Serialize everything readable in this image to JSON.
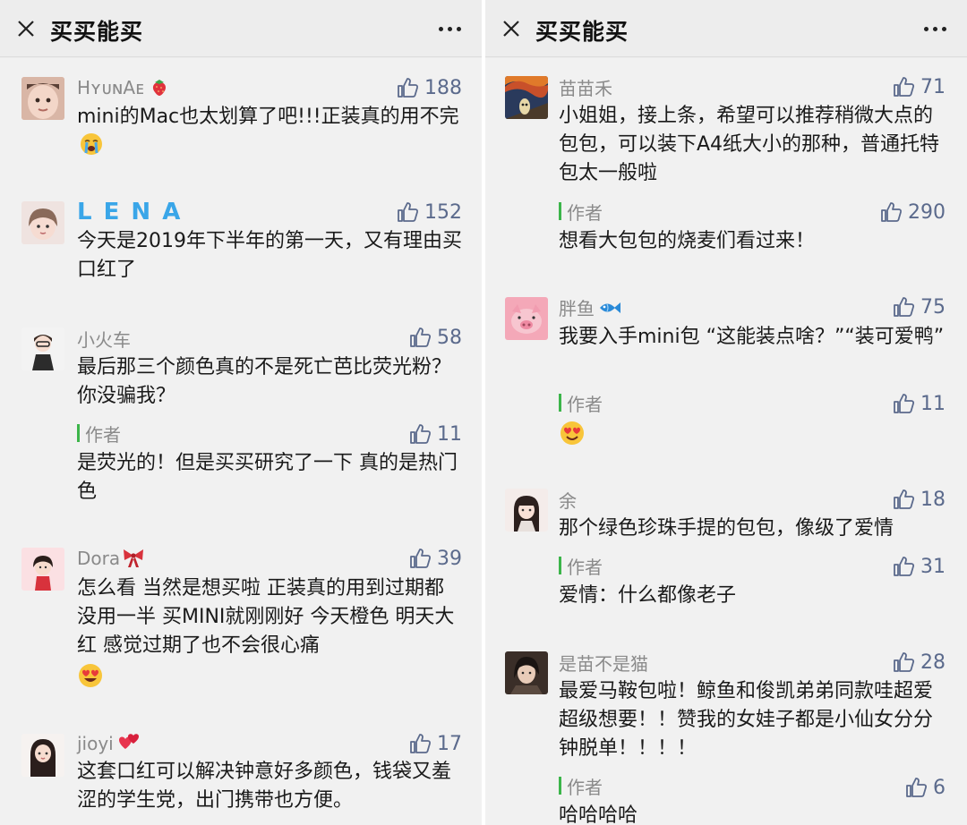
{
  "left": {
    "title": "买买能买",
    "comments": [
      {
        "name": "HʏᴜɴAᴇ",
        "likes": "188",
        "text": "mini的Mac也太划算了吧!!!正装真的用不完"
      },
      {
        "name": "L E N A",
        "likes": "152",
        "text": "今天是2019年下半年的第一天，又有理由买口红了"
      },
      {
        "name": "小火车",
        "likes": "58",
        "text": "最后那三个颜色真的不是死亡芭比荧光粉？你没骗我？",
        "reply": {
          "tag": "作者",
          "likes": "11",
          "text": "是荧光的！但是买买研究了一下 真的是热门色"
        }
      },
      {
        "name": "Dora",
        "likes": "39",
        "text": "怎么看 当然是想买啦 正装真的用到过期都没用一半 买MINI就刚刚好 今天橙色 明天大红 感觉过期了也不会很心痛"
      },
      {
        "name": "jioyi",
        "likes": "17",
        "text": "这套口红可以解决钟意好多颜色，钱袋又羞涩的学生党，出门携带也方便。"
      }
    ]
  },
  "right": {
    "title": "买买能买",
    "comments": [
      {
        "name": "苗苗禾",
        "likes": "71",
        "text": "小姐姐，接上条，希望可以推荐稍微大点的包包，可以装下A4纸大小的那种，普通托特包太一般啦",
        "reply": {
          "tag": "作者",
          "likes": "290",
          "text": "想看大包包的烧麦们看过来！"
        }
      },
      {
        "name": "胖鱼",
        "likes": "75",
        "text": "我要入手mini包 “这能装点啥？”“装可爱鸭”",
        "reply": {
          "tag": "作者",
          "likes": "11",
          "text": ""
        }
      },
      {
        "name": "余",
        "likes": "18",
        "text": "那个绿色珍珠手提的包包，像级了爱情",
        "reply": {
          "tag": "作者",
          "likes": "31",
          "text": "爱情：什么都像老子"
        }
      },
      {
        "name": "是苗不是猫",
        "likes": "28",
        "text": "最爱马鞍包啦！鲸鱼和俊凯弟弟同款哇超爱超级想要！！赞我的女娃子都是小仙女分分钟脱单！！！！",
        "reply": {
          "tag": "作者",
          "likes": "6",
          "text": "哈哈哈哈"
        }
      }
    ]
  },
  "colors": {
    "header_bg": "#ededed",
    "like_blue": "#5b6a8c",
    "author_green": "#3cb54a",
    "lena_blue": "#3aa6e8"
  },
  "icons": {
    "close": "close-icon",
    "more": "more-icon",
    "like": "thumbs-up-icon"
  }
}
